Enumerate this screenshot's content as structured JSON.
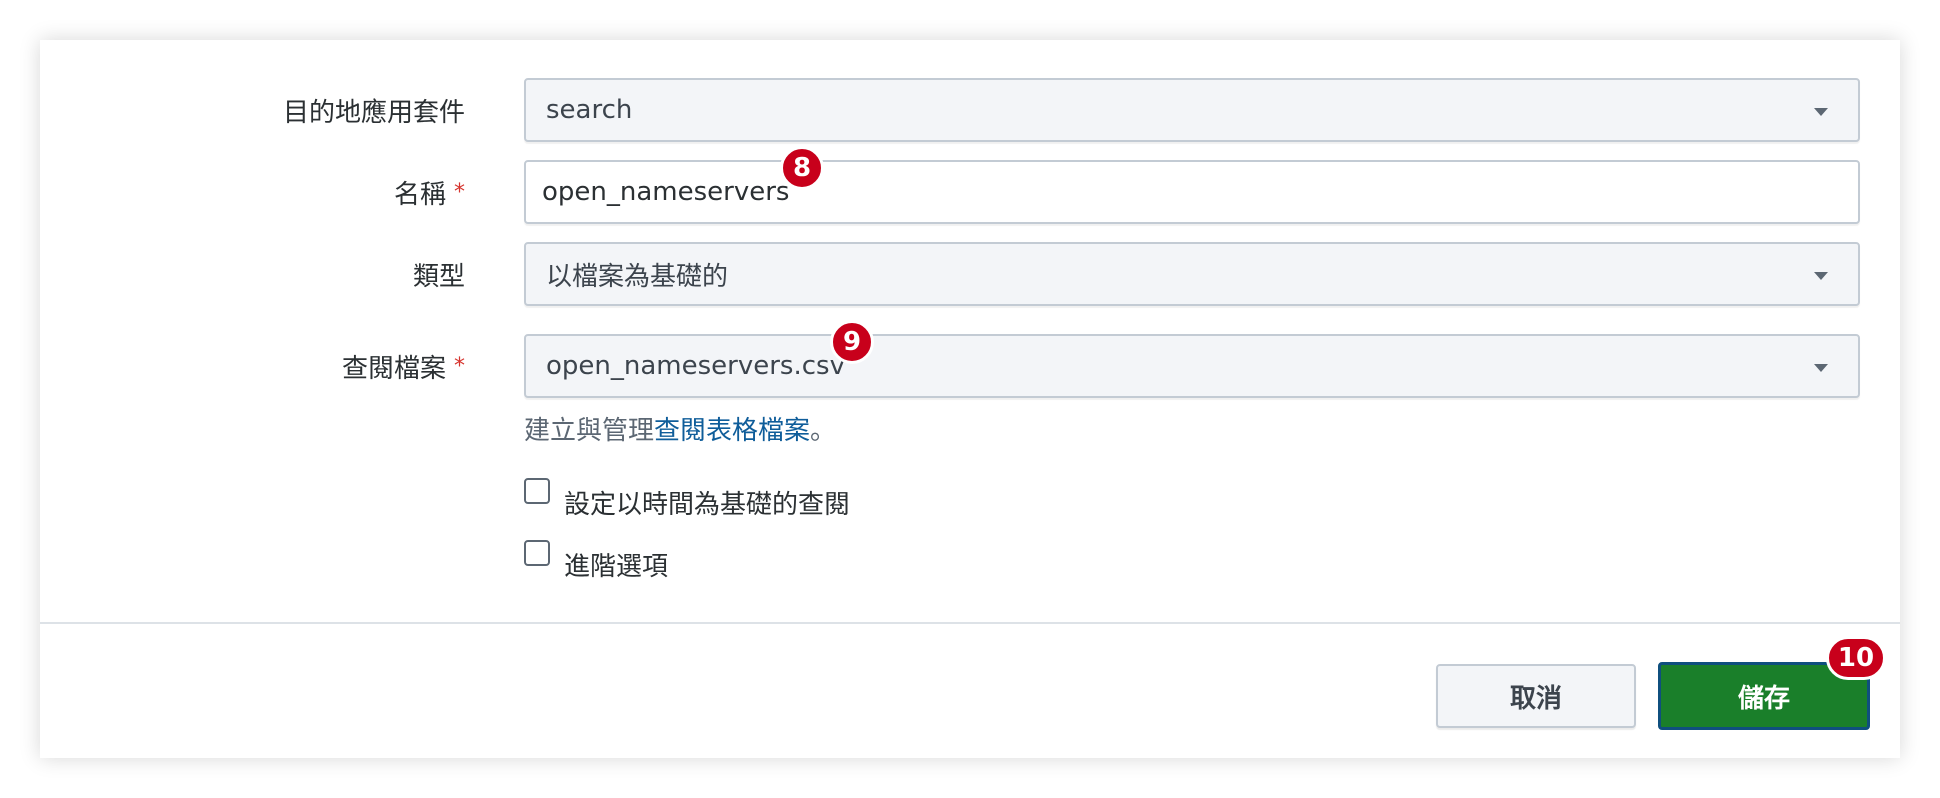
{
  "form": {
    "app": {
      "label": "目的地應用套件",
      "value": "search"
    },
    "name": {
      "label": "名稱",
      "required_mark": "*",
      "value": "open_nameservers"
    },
    "type": {
      "label": "類型",
      "value": "以檔案為基礎的"
    },
    "lookup_file": {
      "label": "查閱檔案",
      "required_mark": "*",
      "value": "open_nameservers.csv"
    },
    "help": {
      "prefix": "建立與管理",
      "link": "查閱表格檔案",
      "suffix": "。"
    },
    "checkboxes": [
      {
        "label": "設定以時間為基礎的查閱",
        "checked": false
      },
      {
        "label": "進階選項",
        "checked": false
      }
    ]
  },
  "footer": {
    "cancel_label": "取消",
    "save_label": "儲存"
  },
  "badges": [
    "8",
    "9",
    "10"
  ],
  "colors": {
    "save_bg": "#1a7f2a",
    "badge_bg": "#c8001b",
    "link": "#0f5d9a",
    "required": "#d6342e"
  }
}
